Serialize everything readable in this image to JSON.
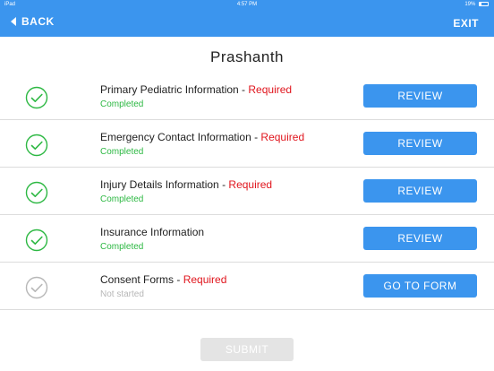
{
  "status_bar": {
    "device": "iPad",
    "time": "4:57 PM",
    "battery": "19%"
  },
  "header": {
    "back_label": "BACK",
    "exit_label": "EXIT",
    "bg_color": "#3b95ee"
  },
  "page_title": "Prashanth",
  "required_label": "Required",
  "colors": {
    "completed": "#2db843",
    "not_started": "#b7b7b7",
    "required": "#e0151d",
    "button": "#3b95ee"
  },
  "items": [
    {
      "title": "Primary Pediatric Information",
      "separator": " - ",
      "required": "Required",
      "status": "Completed",
      "action": "REVIEW",
      "done": true
    },
    {
      "title": "Emergency Contact Information",
      "separator": " - ",
      "required": "Required",
      "status": "Completed",
      "action": "REVIEW",
      "done": true
    },
    {
      "title": "Injury Details Information",
      "separator": " - ",
      "required": "Required",
      "status": "Completed",
      "action": "REVIEW",
      "done": true
    },
    {
      "title": "Insurance Information",
      "separator": "",
      "required": "",
      "status": "Completed",
      "action": "REVIEW",
      "done": true
    },
    {
      "title": "Consent Forms",
      "separator": " - ",
      "required": "Required",
      "status": "Not started",
      "action": "GO TO FORM",
      "done": false
    }
  ],
  "submit_label": "SUBMIT"
}
